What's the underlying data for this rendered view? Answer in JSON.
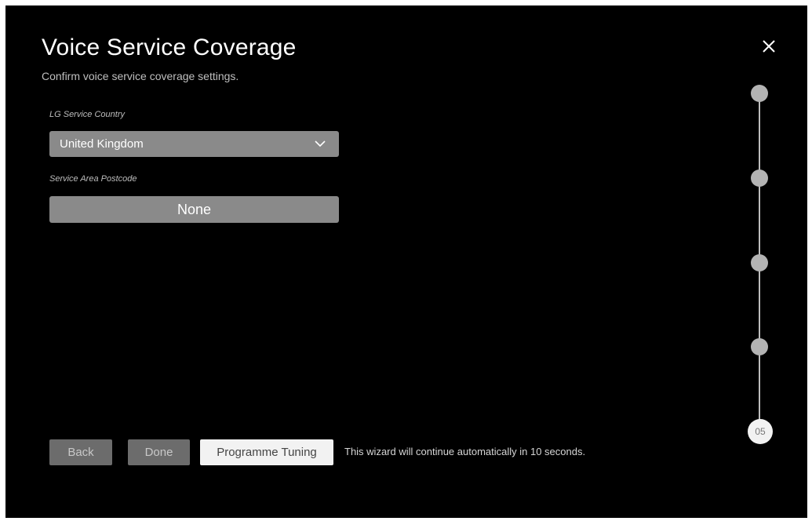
{
  "header": {
    "title": "Voice Service Coverage",
    "subtitle": "Confirm voice service coverage settings."
  },
  "close_icon": "close-icon",
  "form": {
    "country_label": "LG Service Country",
    "country_value": "United Kingdom",
    "postcode_label": "Service Area Postcode",
    "postcode_value": "None"
  },
  "footer": {
    "back_label": "Back",
    "done_label": "Done",
    "tuning_label": "Programme Tuning",
    "hint": "This wizard will continue automatically in 10 seconds."
  },
  "progress": {
    "current_step": "05",
    "total_dots": 5
  },
  "colors": {
    "background": "#000000",
    "field": "#8a8a8a",
    "button_gray": "#6c6c6c",
    "button_white": "#f2f2f2"
  }
}
